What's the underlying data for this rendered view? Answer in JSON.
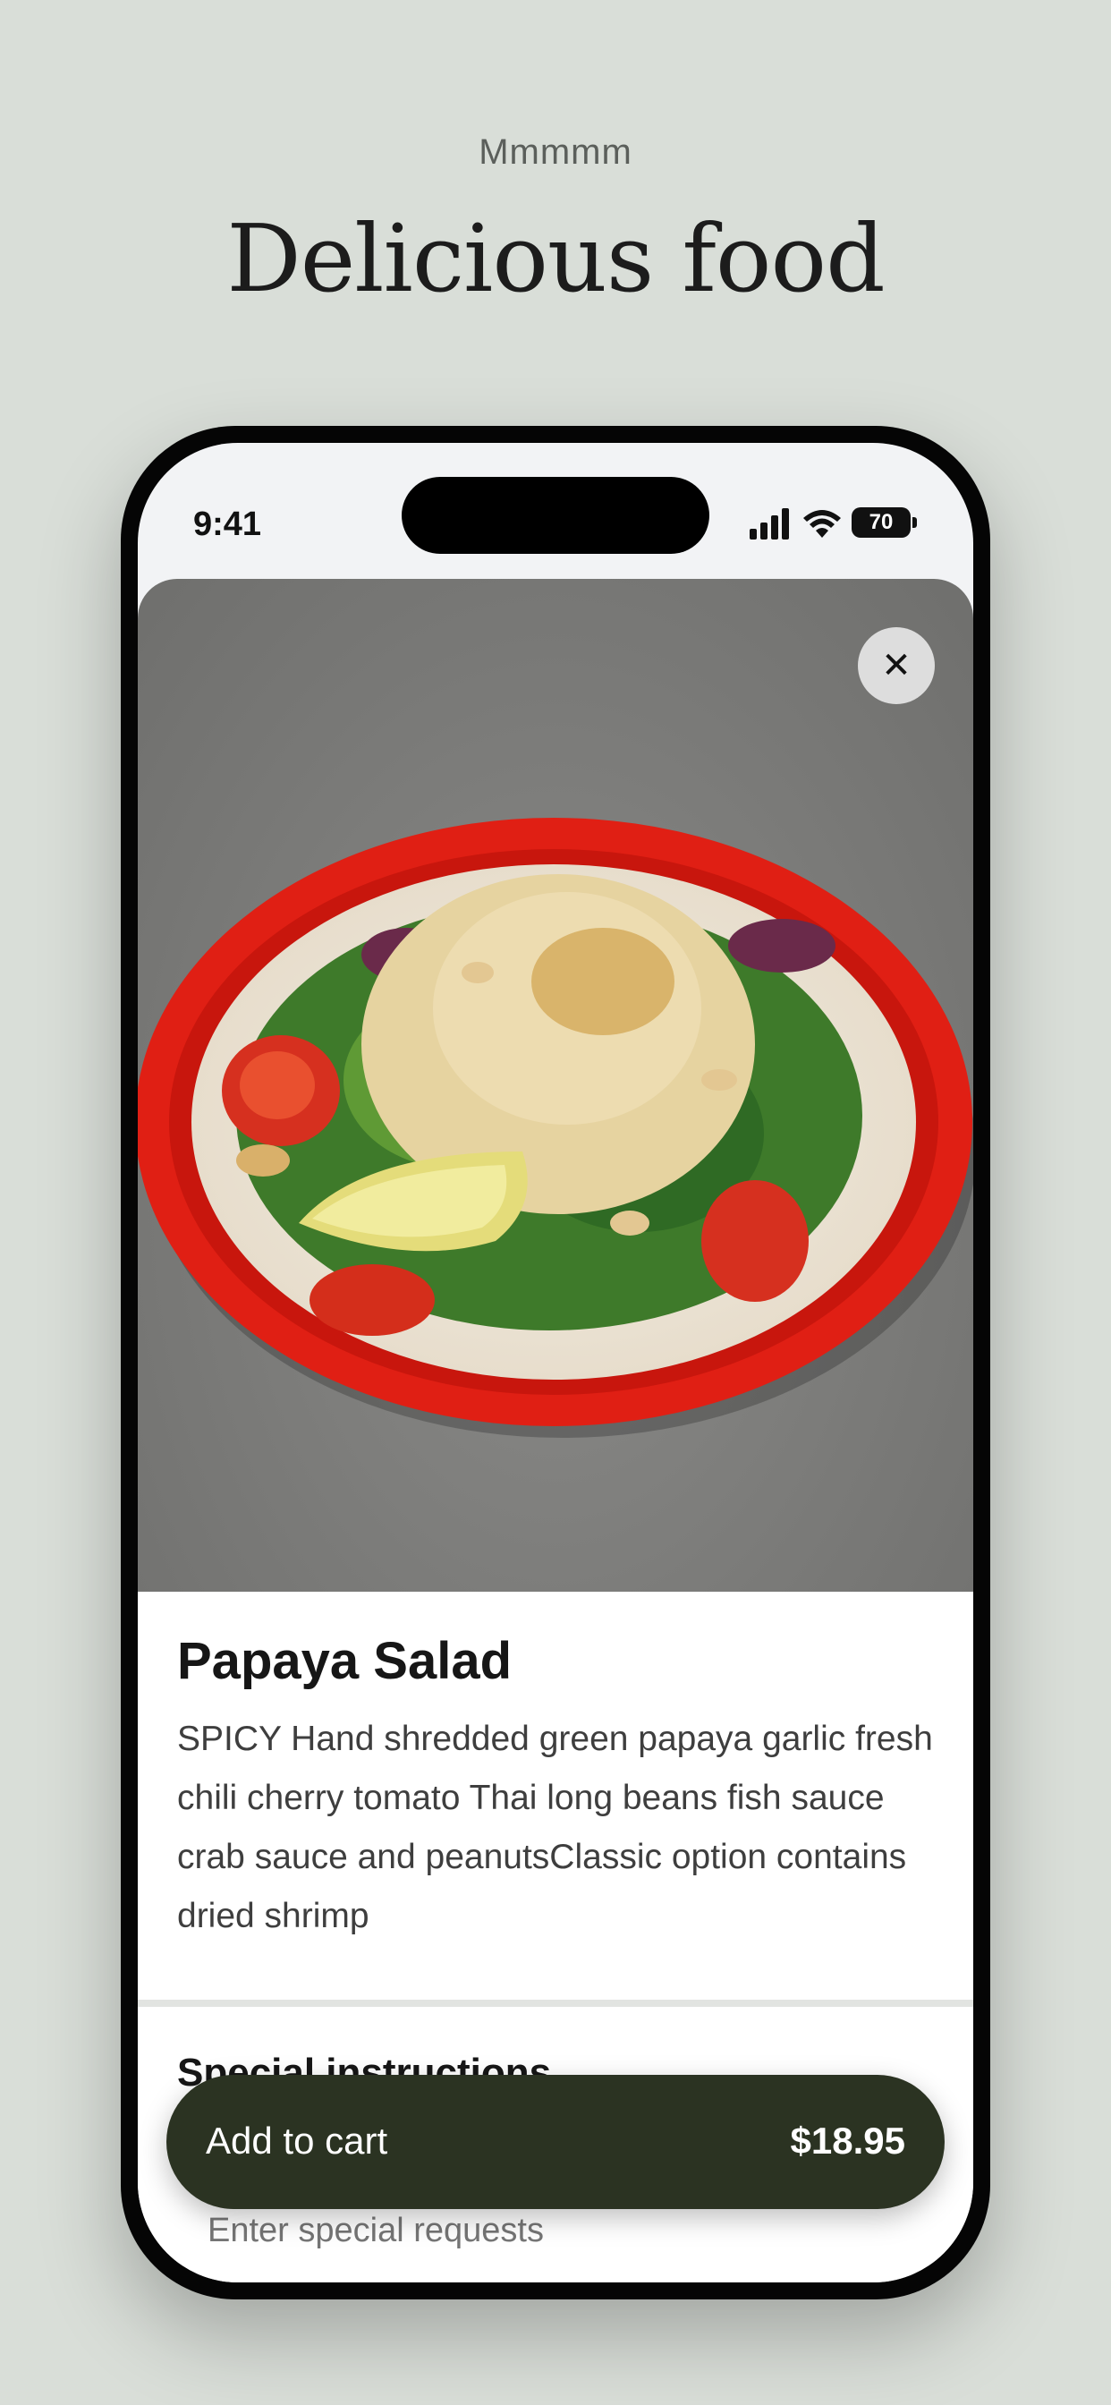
{
  "promo": {
    "eyebrow": "Mmmmm",
    "title": "Delicious food"
  },
  "status_bar": {
    "time": "9:41",
    "battery": "70"
  },
  "close_icon": "close-icon",
  "dish": {
    "name": "Papaya Salad",
    "description": "SPICY Hand shredded green papaya garlic fresh chili cherry tomato Thai long beans fish sauce crab sauce and peanutsClassic option contains dried shrimp"
  },
  "special_instructions": {
    "title": "Special instructions",
    "placeholder": "Enter special requests"
  },
  "cart": {
    "label": "Add to cart",
    "price": "$18.95",
    "color": "#2b3322"
  },
  "colors": {
    "background": "#d9ded8",
    "plate_red": "#e01f14"
  }
}
